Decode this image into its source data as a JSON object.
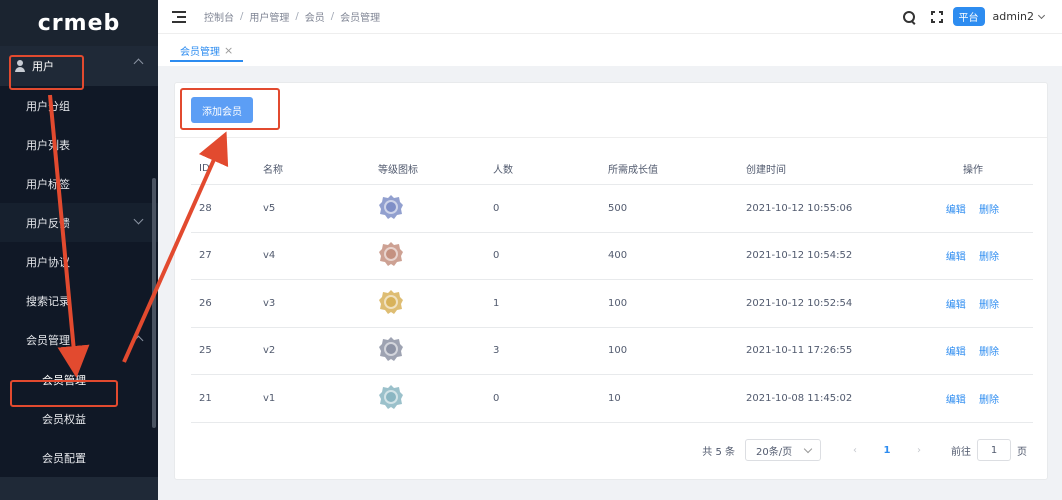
{
  "app": {
    "logo": "crmeb"
  },
  "sidebar": {
    "parent": {
      "label": "用户",
      "icon": "user-icon"
    },
    "items": [
      {
        "label": "用户分组"
      },
      {
        "label": "用户列表"
      },
      {
        "label": "用户标签"
      },
      {
        "label": "用户反馈"
      },
      {
        "label": "用户协议"
      },
      {
        "label": "搜索记录"
      }
    ],
    "group": {
      "label": "会员管理"
    },
    "group_items": [
      {
        "label": "会员管理"
      },
      {
        "label": "会员权益"
      },
      {
        "label": "会员配置"
      }
    ]
  },
  "header": {
    "breadcrumb": [
      "控制台",
      "用户管理",
      "会员",
      "会员管理"
    ],
    "platform_badge": "平台",
    "admin": "admin2"
  },
  "tabs": [
    {
      "label": "会员管理",
      "close": "×"
    }
  ],
  "toolbar": {
    "add_label": "添加会员"
  },
  "table": {
    "headers": [
      "ID",
      "名称",
      "等级图标",
      "人数",
      "所需成长值",
      "创建时间",
      "操作"
    ],
    "rows": [
      {
        "id": "28",
        "name": "v5",
        "icon_color": "#7f8fc7",
        "count": "0",
        "growth": "500",
        "created": "2021-10-12 10:55:06",
        "edit": "编辑",
        "del": "删除"
      },
      {
        "id": "27",
        "name": "v4",
        "icon_color": "#c49180",
        "count": "0",
        "growth": "400",
        "created": "2021-10-12 10:54:52",
        "edit": "编辑",
        "del": "删除"
      },
      {
        "id": "26",
        "name": "v3",
        "icon_color": "#d8b25a",
        "count": "1",
        "growth": "100",
        "created": "2021-10-12 10:52:54",
        "edit": "编辑",
        "del": "删除"
      },
      {
        "id": "25",
        "name": "v2",
        "icon_color": "#8d93a5",
        "count": "3",
        "growth": "100",
        "created": "2021-10-11 17:26:55",
        "edit": "编辑",
        "del": "删除"
      },
      {
        "id": "21",
        "name": "v1",
        "icon_color": "#8ab6c2",
        "count": "0",
        "growth": "10",
        "created": "2021-10-08 11:45:02",
        "edit": "编辑",
        "del": "删除"
      }
    ]
  },
  "pager": {
    "total": "共 5 条",
    "size": "20条/页",
    "prev": "‹",
    "page": "1",
    "next": "›",
    "goto_label": "前往",
    "goto_value": "1",
    "goto_suffix": "页"
  },
  "colors": {
    "accent": "#2d8cf0",
    "annotation": "#e24a2f",
    "sidebar_bg": "#1f2937"
  }
}
